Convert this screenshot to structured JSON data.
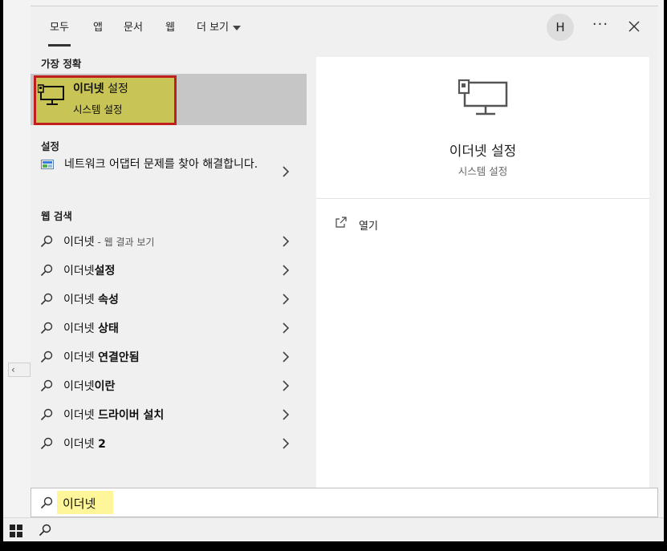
{
  "tabs": [
    {
      "label": "모두",
      "active": true
    },
    {
      "label": "앱",
      "active": false
    },
    {
      "label": "문서",
      "active": false
    },
    {
      "label": "웹",
      "active": false
    },
    {
      "label": "더 보기",
      "active": false
    }
  ],
  "header": {
    "avatar_initial": "H",
    "more_glyph": "···"
  },
  "sections": {
    "best_match": "가장 정확",
    "settings": "설정",
    "web_search": "웹 검색"
  },
  "best_match": {
    "title": "이더넷",
    "title_suffix": " 설정",
    "subtitle": "시스템 설정",
    "icon": "ethernet-monitor-icon"
  },
  "setting_item": {
    "label": "네트워크 어댑터 문제를 찾아 해결합니다.",
    "icon": "troubleshoot-network-icon"
  },
  "web_items": [
    {
      "prefix": "이더넷",
      "bold": "",
      "sub": " - 웹 결과 보기"
    },
    {
      "prefix": "이더넷",
      "bold": "설정",
      "sub": ""
    },
    {
      "prefix": "이더넷 ",
      "bold": "속성",
      "sub": ""
    },
    {
      "prefix": "이더넷 ",
      "bold": "상태",
      "sub": ""
    },
    {
      "prefix": "이더넷 ",
      "bold": "연결안됨",
      "sub": ""
    },
    {
      "prefix": "이더넷",
      "bold": "이란",
      "sub": ""
    },
    {
      "prefix": "이더넷 ",
      "bold": "드라이버 설치",
      "sub": ""
    },
    {
      "prefix": "이더넷 ",
      "bold": "2",
      "sub": ""
    }
  ],
  "preview": {
    "title": "이더넷 설정",
    "subtitle": "시스템 설정",
    "open_label": "열기"
  },
  "search": {
    "value": "이더넷"
  },
  "colors": {
    "highlight": "#c8c455",
    "highlight_border": "#c0201d",
    "search_highlight": "#fff599",
    "selected_row": "#c6c6c6"
  }
}
